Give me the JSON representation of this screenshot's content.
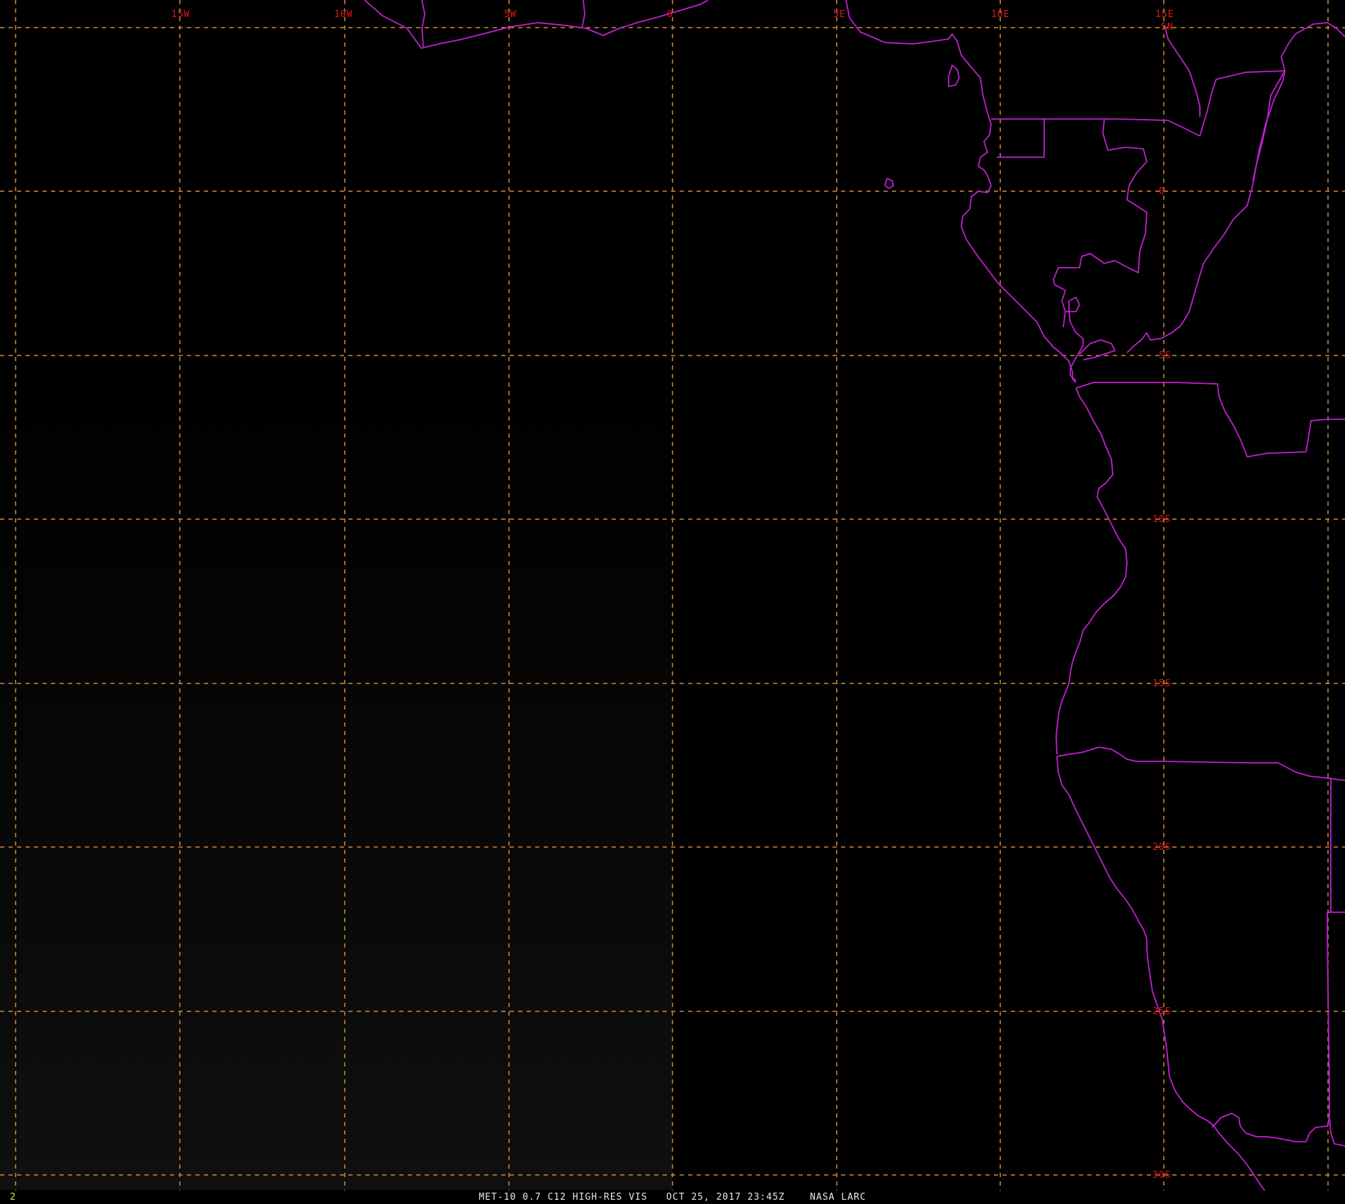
{
  "map": {
    "lon_labels": [
      "15W",
      "10W",
      "5W",
      "0",
      "5E",
      "10E",
      "15E"
    ],
    "lat_labels": [
      "5N",
      "0",
      "5S",
      "10S",
      "15S",
      "20S",
      "25S",
      "30S"
    ],
    "colors": {
      "background": "#000000",
      "grid": "#d48a3c",
      "boundaries": "#c020d0",
      "labels": "#e01818",
      "caption": "#e8e8e8",
      "frame_number": "#e0e020"
    }
  },
  "footer": {
    "frame_number": "2",
    "caption": "MET-10 0.7 C12 HIGH-RES VIS   OCT 25, 2017 23:45Z    NASA LARC"
  }
}
